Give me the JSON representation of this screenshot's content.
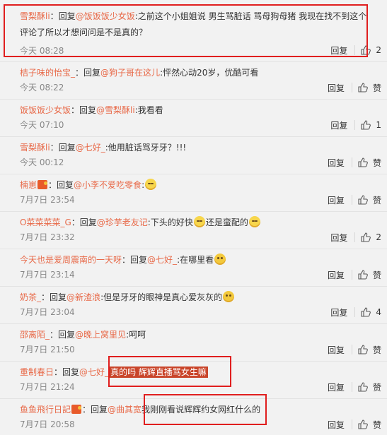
{
  "labels": {
    "reply": "回复",
    "replyto": "回复",
    "like_label": "赞"
  },
  "comments": [
    {
      "user": "雪梨酥li",
      "sep": "：",
      "reply_prefix": "回复",
      "target": "@饭饭饭少女饭",
      "text": ":之前这个小姐姐说 男生骂脏话 骂母狗母猪 我现在找不到这个评论了所以才想问问是不是真的？",
      "time": "今天 08:28",
      "likes": "2"
    },
    {
      "user": "桔子味的怡宝_",
      "sep": "：",
      "reply_prefix": "回复",
      "target": "@狗子哥在这儿",
      "text": ":怦然心动20岁，优酷可看",
      "time": "今天 08:22",
      "likes": "赞"
    },
    {
      "user": "饭饭饭少女饭",
      "sep": "：",
      "reply_prefix": "回复",
      "target": "@雪梨酥li",
      "text": ":我看看",
      "time": "今天 07:10",
      "likes": "1"
    },
    {
      "user": "雪梨酥li",
      "sep": "：",
      "reply_prefix": "回复",
      "target": "@七好_",
      "text": ":他用脏话骂牙牙？!!!",
      "time": "今天 00:12",
      "likes": "赞"
    },
    {
      "user": "楠崽",
      "sep": "：",
      "reply_prefix": "回复",
      "target": "@小李不爱吃零食",
      "text": ":",
      "time": "7月7日 23:54",
      "likes": "赞"
    },
    {
      "user": "O菜菜菜菜_G",
      "sep": "：",
      "reply_prefix": "回复",
      "target": "@珍芋老友记",
      "text": ":下头的好快",
      "text2": "还是蛮配的",
      "time": "7月7日 23:32",
      "likes": "2"
    },
    {
      "user": "今天也是爱周震南的一天呀",
      "sep": "：",
      "reply_prefix": "回复",
      "target": "@七好_",
      "text": ":在哪里看",
      "time": "7月7日 23:14",
      "likes": "赞"
    },
    {
      "user": "奶茶_",
      "sep": "：",
      "reply_prefix": "回复",
      "target": "@新渣浪",
      "text": ":但是牙牙的眼神是真心爱灰灰的",
      "time": "7月7日 23:04",
      "likes": "4"
    },
    {
      "user": "邵离陌_",
      "sep": "：",
      "reply_prefix": "回复",
      "target": "@晚上窝里见",
      "text": ":呵呵",
      "time": "7月7日 21:50",
      "likes": "赞"
    },
    {
      "user": "重制春日",
      "sep": "：",
      "reply_prefix": "回复",
      "target": "@七好_",
      "text": "真的吗 辉辉直播骂女生嘛",
      "time": "7月7日 21:24",
      "likes": "赞"
    },
    {
      "user": "鱼鱼飛行日記",
      "sep": "：",
      "reply_prefix": "回复",
      "target": "@曲其宽",
      "text": "我刚刚看说辉辉约女网红什么的",
      "time": "7月7日 20:58",
      "likes": "赞"
    }
  ]
}
